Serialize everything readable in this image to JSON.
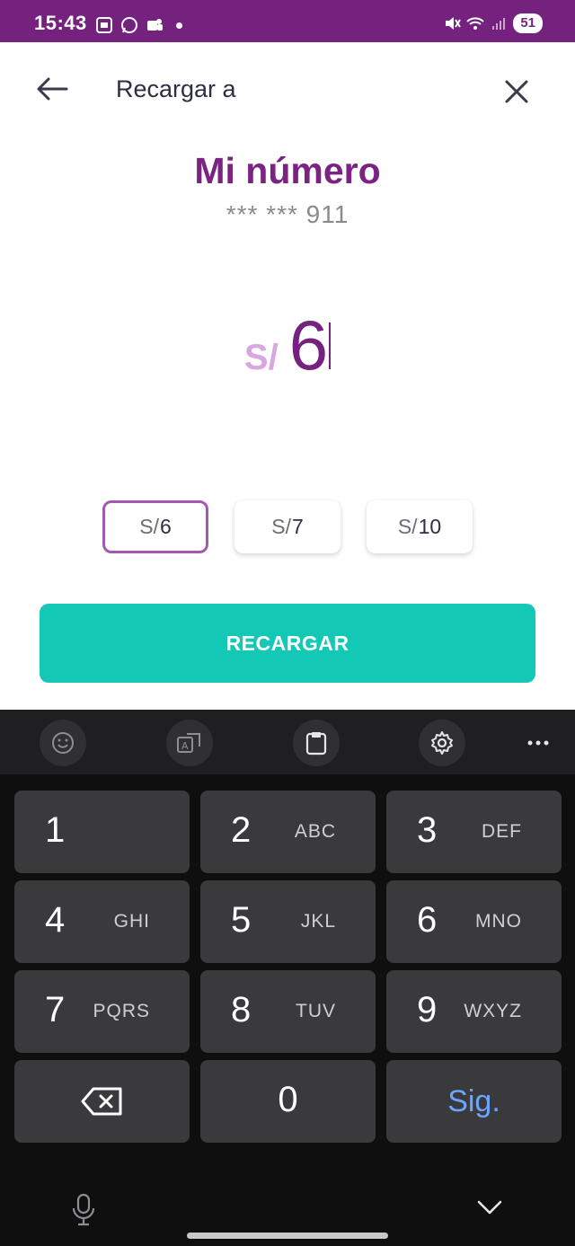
{
  "status_bar": {
    "time": "15:43",
    "battery": "51",
    "background_color": "#75227f"
  },
  "header": {
    "title": "Recargar a",
    "back_icon": "arrow-left-icon",
    "close_icon": "close-icon"
  },
  "contact": {
    "name": "Mi número",
    "number": "*** *** 911"
  },
  "amount": {
    "currency": "S/",
    "value": "6"
  },
  "chips": [
    {
      "currency": "S/",
      "value": "6",
      "selected": true
    },
    {
      "currency": "S/",
      "value": "7",
      "selected": false
    },
    {
      "currency": "S/",
      "value": "10",
      "selected": false
    }
  ],
  "action": {
    "label": "RECARGAR",
    "color": "#14c8b6"
  },
  "keyboard": {
    "toolbar_icons": [
      "emoji-icon",
      "translate-icon",
      "clipboard-icon",
      "settings-icon",
      "more-icon"
    ],
    "keys": [
      {
        "num": "1",
        "letters": ""
      },
      {
        "num": "2",
        "letters": "ABC"
      },
      {
        "num": "3",
        "letters": "DEF"
      },
      {
        "num": "4",
        "letters": "GHI"
      },
      {
        "num": "5",
        "letters": "JKL"
      },
      {
        "num": "6",
        "letters": "MNO"
      },
      {
        "num": "7",
        "letters": "PQRS"
      },
      {
        "num": "8",
        "letters": "TUV"
      },
      {
        "num": "9",
        "letters": "WXYZ"
      }
    ],
    "zero": "0",
    "next_label": "Sig.",
    "delete_icon": "backspace-icon"
  }
}
